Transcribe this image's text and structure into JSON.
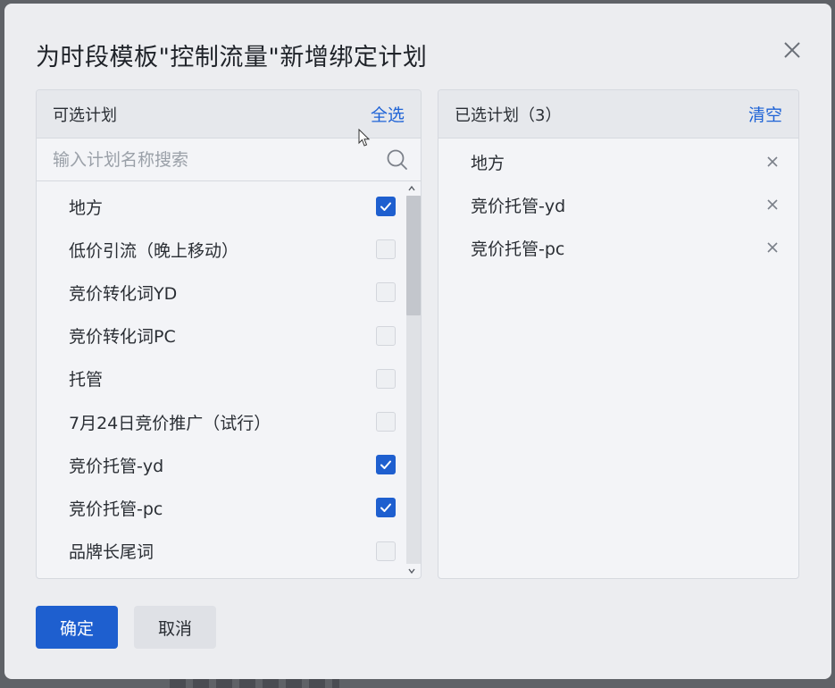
{
  "dialog": {
    "title": "为时段模板\"控制流量\"新增绑定计划",
    "close_icon": "close-icon"
  },
  "available": {
    "header_title": "可选计划",
    "select_all_label": "全选",
    "search_placeholder": "输入计划名称搜索",
    "search_value": "",
    "items": [
      {
        "label": "地方",
        "checked": true
      },
      {
        "label": "低价引流（晚上移动）",
        "checked": false
      },
      {
        "label": "竞价转化词YD",
        "checked": false
      },
      {
        "label": "竞价转化词PC",
        "checked": false
      },
      {
        "label": "托管",
        "checked": false
      },
      {
        "label": "7月24日竞价推广（试行）",
        "checked": false
      },
      {
        "label": "竞价托管-yd",
        "checked": true
      },
      {
        "label": "竞价托管-pc",
        "checked": true
      },
      {
        "label": "品牌长尾词",
        "checked": false
      }
    ]
  },
  "selected": {
    "header_title": "已选计划（3）",
    "clear_label": "清空",
    "items": [
      {
        "label": "地方"
      },
      {
        "label": "竞价托管-yd"
      },
      {
        "label": "竞价托管-pc"
      }
    ]
  },
  "footer": {
    "confirm_label": "确定",
    "cancel_label": "取消"
  },
  "colors": {
    "accent": "#1e5fcf",
    "link": "#1f63d6",
    "dialog_bg": "#ecedf0",
    "panel_bg": "#f3f4f7"
  }
}
